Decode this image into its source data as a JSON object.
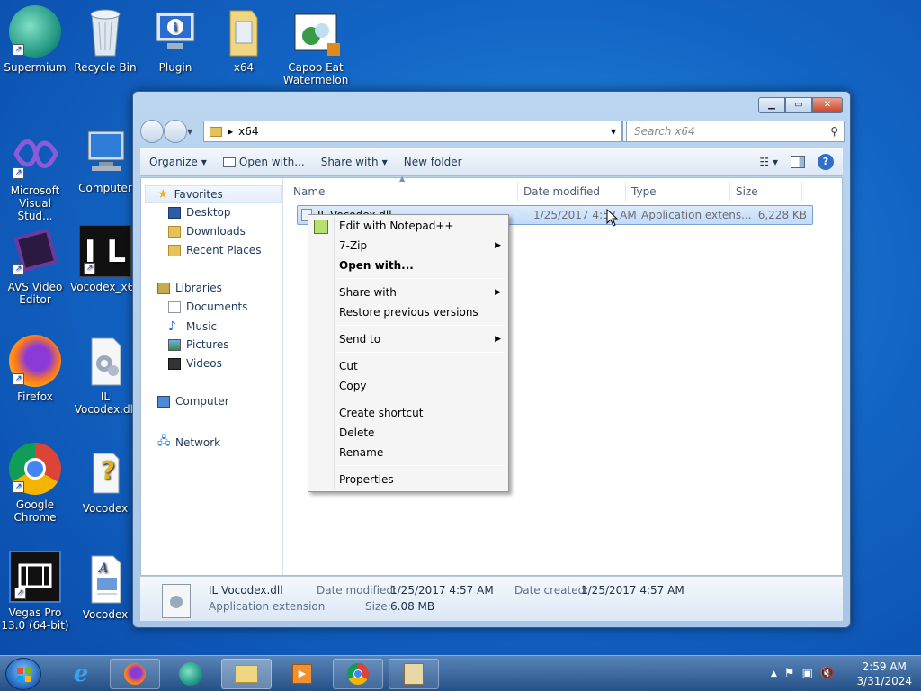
{
  "desktop": {
    "icons": [
      {
        "label": "Supermium"
      },
      {
        "label": "Recycle Bin"
      },
      {
        "label": "Plugin"
      },
      {
        "label": "x64"
      },
      {
        "label": "Capoo Eat Watermelon"
      },
      {
        "label": "Microsoft Visual Stud..."
      },
      {
        "label": "Computer"
      },
      {
        "label": "AVS Video Editor"
      },
      {
        "label": "Vocodex_x64"
      },
      {
        "label": "Firefox"
      },
      {
        "label": "IL Vocodex.dll"
      },
      {
        "label": "Google Chrome"
      },
      {
        "label": "Vocodex"
      },
      {
        "label": "Vegas Pro 13.0 (64-bit)"
      },
      {
        "label": "Vocodex"
      }
    ]
  },
  "window": {
    "address": "x64",
    "search_placeholder": "Search x64",
    "toolbar": {
      "organize": "Organize",
      "open_with": "Open with...",
      "share_with": "Share with",
      "new_folder": "New folder"
    },
    "nav": {
      "favorites": "Favorites",
      "desktop": "Desktop",
      "downloads": "Downloads",
      "recent_places": "Recent Places",
      "libraries": "Libraries",
      "documents": "Documents",
      "music": "Music",
      "pictures": "Pictures",
      "videos": "Videos",
      "computer": "Computer",
      "network": "Network"
    },
    "columns": {
      "name": "Name",
      "date_modified": "Date modified",
      "type": "Type",
      "size": "Size"
    },
    "file": {
      "name": "IL Vocodex.dll",
      "date_modified": "1/25/2017 4:57 AM",
      "type": "Application extens...",
      "size": "6,228 KB"
    },
    "details": {
      "name": "IL Vocodex.dll",
      "type": "Application extension",
      "date_modified_label": "Date modified:",
      "date_modified": "1/25/2017 4:57 AM",
      "size_label": "Size:",
      "size": "6.08 MB",
      "date_created_label": "Date created:",
      "date_created": "1/25/2017 4:57 AM"
    }
  },
  "context_menu": {
    "items": [
      "Edit with Notepad++",
      "7-Zip",
      "Open with...",
      "Share with",
      "Restore previous versions",
      "Send to",
      "Cut",
      "Copy",
      "Create shortcut",
      "Delete",
      "Rename",
      "Properties"
    ]
  },
  "taskbar": {
    "time": "2:59 AM",
    "date": "3/31/2024"
  }
}
